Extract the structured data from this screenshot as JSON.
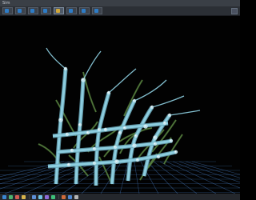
{
  "window": {
    "title": "Sim"
  },
  "toolbar": {
    "tabs": [
      {
        "label": "",
        "active": false,
        "color": "#2e7cc6"
      },
      {
        "label": "",
        "active": false,
        "color": "#2e7cc6"
      },
      {
        "label": "",
        "active": false,
        "color": "#2e7cc6"
      },
      {
        "label": "",
        "active": false,
        "color": "#2e7cc6"
      },
      {
        "label": "",
        "active": true,
        "color": "#d0a73a"
      },
      {
        "label": "",
        "active": false,
        "color": "#2e7cc6"
      },
      {
        "label": "",
        "active": false,
        "color": "#2e7cc6"
      },
      {
        "label": "",
        "active": false,
        "color": "#2e7cc6"
      }
    ]
  },
  "viewport": {
    "background": "#020202",
    "model_colors": {
      "stem": "#8fd1e3",
      "node": "#c7e7f0",
      "foliage": "#4f7a3a",
      "grid": "#3d6aa6"
    }
  },
  "status_bar": {
    "icons": [
      "#3b86d1",
      "#4bb36f",
      "#d45a52",
      "#d7b44c",
      "#5c8fd6",
      "#6fc3e3",
      "#8f6bd8",
      "#3ec07a",
      "#d06b3a",
      "#4d86d1",
      "#b5b5b5"
    ]
  }
}
